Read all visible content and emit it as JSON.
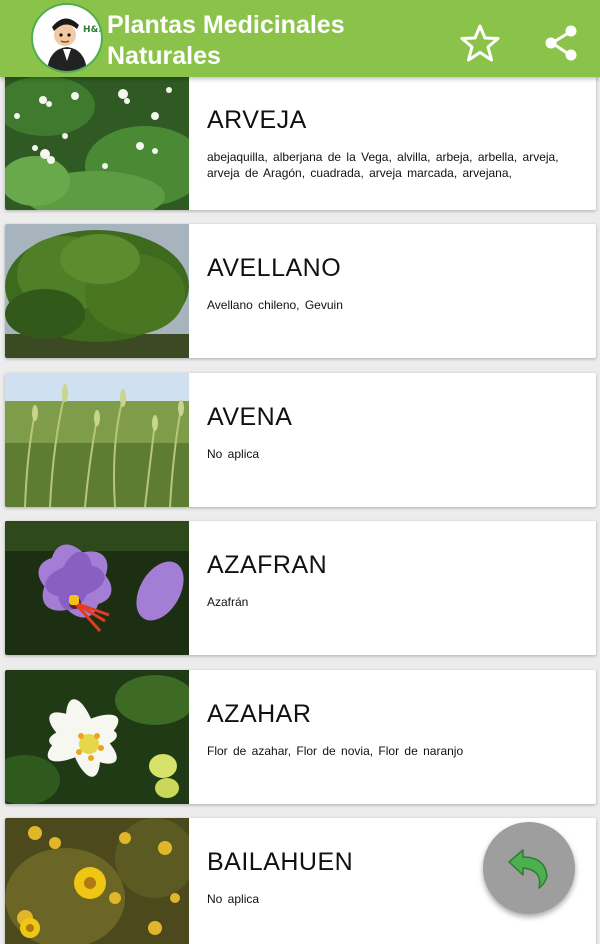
{
  "app": {
    "title_line1": "Plantas Medicinales",
    "title_line2": "Naturales",
    "logo_letters": "H&S",
    "theme_color": "#8bc34a",
    "logo_icon": "herbalist-avatar-icon",
    "actions": [
      {
        "icon": "star-outline-icon"
      },
      {
        "icon": "share-icon"
      }
    ]
  },
  "plants": [
    {
      "name": "ARVEJA",
      "aliases": "abejaquilla,  alberjana de la Vega,  alvilla,  arbeja,  arbella,  arveja,  arveja de Aragón,  cuadrada,  arveja marcada,  arvejana,",
      "image": "pea-plant-photo"
    },
    {
      "name": "AVELLANO",
      "aliases": "Avellano chileno, Gevuin",
      "image": "hazel-tree-photo"
    },
    {
      "name": "AVENA",
      "aliases": "No aplica",
      "image": "oat-field-photo"
    },
    {
      "name": "AZAFRAN",
      "aliases": "Azafrán",
      "image": "saffron-flower-photo"
    },
    {
      "name": "AZAHAR",
      "aliases": "Flor de azahar, Flor de novia, Flor de naranjo",
      "image": "orange-blossom-photo"
    },
    {
      "name": "BAILAHUEN",
      "aliases": "No aplica",
      "image": "bailahuen-flowers-photo"
    }
  ],
  "fab": {
    "icon": "undo-arrow-icon",
    "color": "#9e9e9e",
    "arrow_color": "#4caf50"
  }
}
